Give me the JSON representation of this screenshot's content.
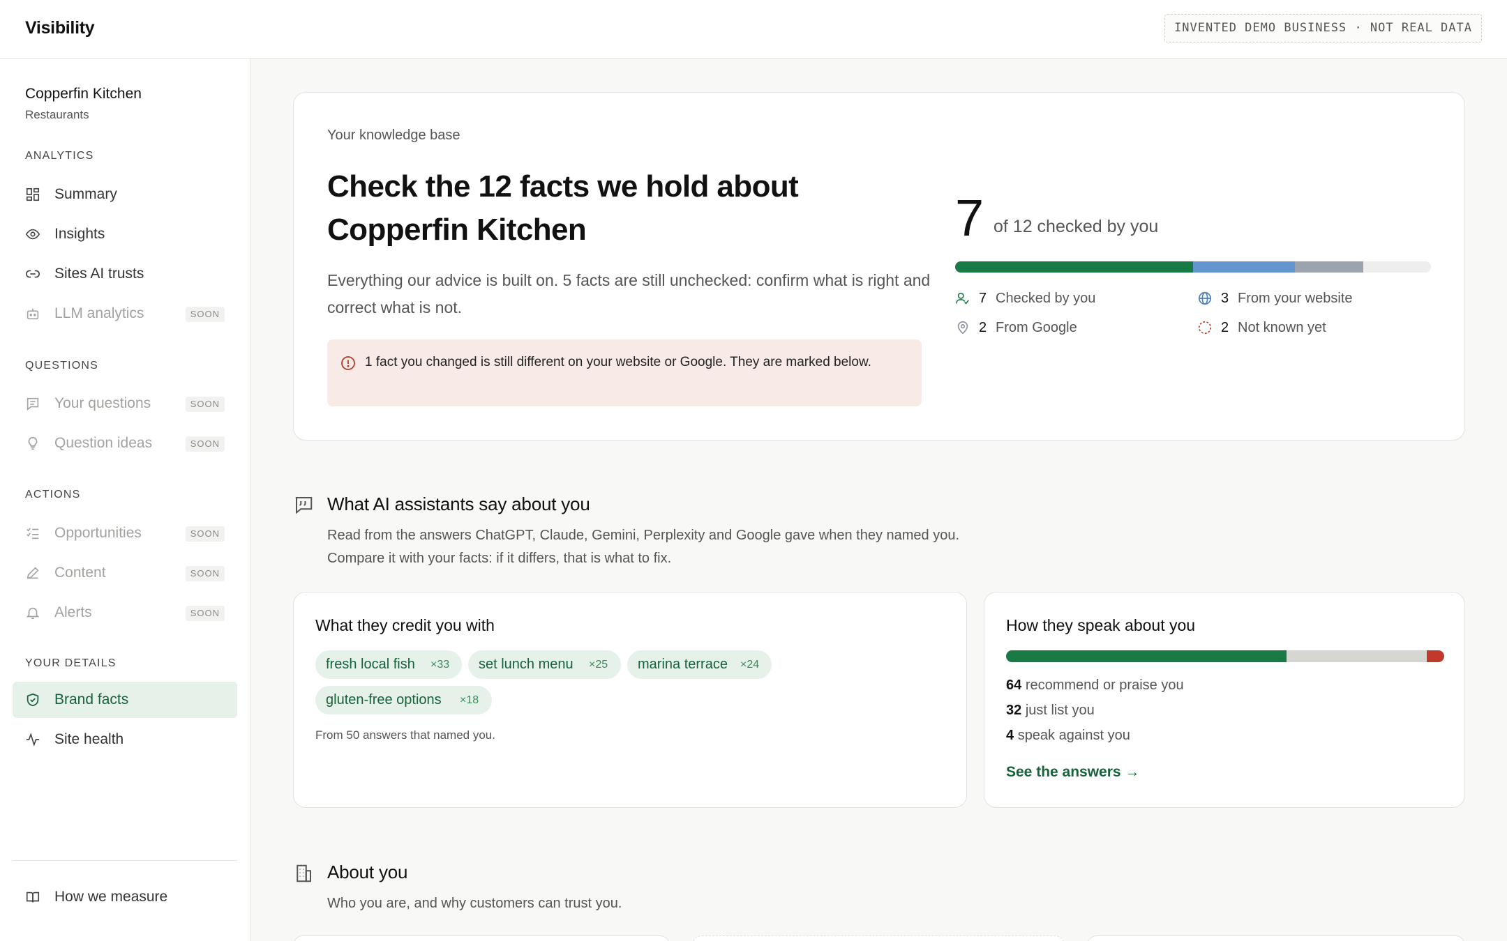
{
  "app": {
    "title": "Visibility",
    "demo_badge": "INVENTED DEMO BUSINESS · NOT REAL DATA"
  },
  "sidebar": {
    "business_name": "Copperfin Kitchen",
    "business_category": "Restaurants",
    "sections": {
      "analytics": "ANALYTICS",
      "questions": "QUESTIONS",
      "actions": "ACTIONS",
      "your_details": "YOUR DETAILS"
    },
    "items": {
      "summary": {
        "label": "Summary",
        "icon": "grid-icon"
      },
      "insights": {
        "label": "Insights",
        "icon": "eye-icon"
      },
      "sites_ai_trusts": {
        "label": "Sites AI trusts",
        "icon": "link-icon"
      },
      "llm_analytics": {
        "label": "LLM analytics",
        "icon": "robot-icon",
        "badge": "SOON"
      },
      "your_questions": {
        "label": "Your questions",
        "icon": "message-icon",
        "badge": "SOON"
      },
      "question_ideas": {
        "label": "Question ideas",
        "icon": "lightbulb-icon",
        "badge": "SOON"
      },
      "opportunities": {
        "label": "Opportunities",
        "icon": "checklist-icon",
        "badge": "SOON"
      },
      "content": {
        "label": "Content",
        "icon": "pen-icon",
        "badge": "SOON"
      },
      "alerts": {
        "label": "Alerts",
        "icon": "bell-icon",
        "badge": "SOON"
      },
      "brand_facts": {
        "label": "Brand facts",
        "icon": "shield-check-icon",
        "active": true
      },
      "site_health": {
        "label": "Site health",
        "icon": "pulse-icon"
      },
      "how_we_measure": {
        "label": "How we measure",
        "icon": "book-icon"
      }
    }
  },
  "knowledge": {
    "eyebrow": "Your knowledge base",
    "title": "Check the 12 facts we hold about Copperfin Kitchen",
    "description": "Everything our advice is built on. 5 facts are still unchecked: confirm what is right and correct what is not.",
    "alert": "1 fact you changed is still different on your website or Google. They are marked below.",
    "checked": "7",
    "total_label": "of 12 checked by you",
    "breakdown": [
      {
        "key": "checked",
        "count": "7",
        "label": "Checked by you",
        "color": "#1a7a45",
        "icon": "user-check-icon"
      },
      {
        "key": "website",
        "count": "3",
        "label": "From your website",
        "color": "#6595cf",
        "icon": "globe-icon"
      },
      {
        "key": "google",
        "count": "2",
        "label": "From Google",
        "color": "#9aa3ae",
        "icon": "map-pin-icon"
      },
      {
        "key": "unknown",
        "count": "2",
        "label": "Not known yet",
        "color": "#eeeeec",
        "icon": "dashed-circle-icon"
      }
    ]
  },
  "ai_section": {
    "title": "What AI assistants say about you",
    "subtitle_1": "Read from the answers ChatGPT, Claude, Gemini, Perplexity and Google gave when they named you.",
    "subtitle_2": "Compare it with your facts: if it differs, that is what to fix."
  },
  "credit": {
    "heading": "What they credit you with",
    "chips": [
      {
        "text": "fresh local fish",
        "count": "×33"
      },
      {
        "text": "set lunch menu",
        "count": "×25"
      },
      {
        "text": "marina terrace",
        "count": "×24"
      },
      {
        "text": "gluten-free options",
        "count": "×18"
      }
    ],
    "footnote": "From 50 answers that named you."
  },
  "speak": {
    "heading": "How they speak about you",
    "rows": [
      {
        "count": "64",
        "label": "recommend or praise you",
        "color": "#1a7a45"
      },
      {
        "count": "32",
        "label": "just list you",
        "color": "#d6d6d3"
      },
      {
        "count": "4",
        "label": "speak against you",
        "color": "#c0392b"
      }
    ],
    "link": "See the answers →"
  },
  "about": {
    "title": "About you",
    "subtitle": "Who you are, and why customers can trust you."
  }
}
